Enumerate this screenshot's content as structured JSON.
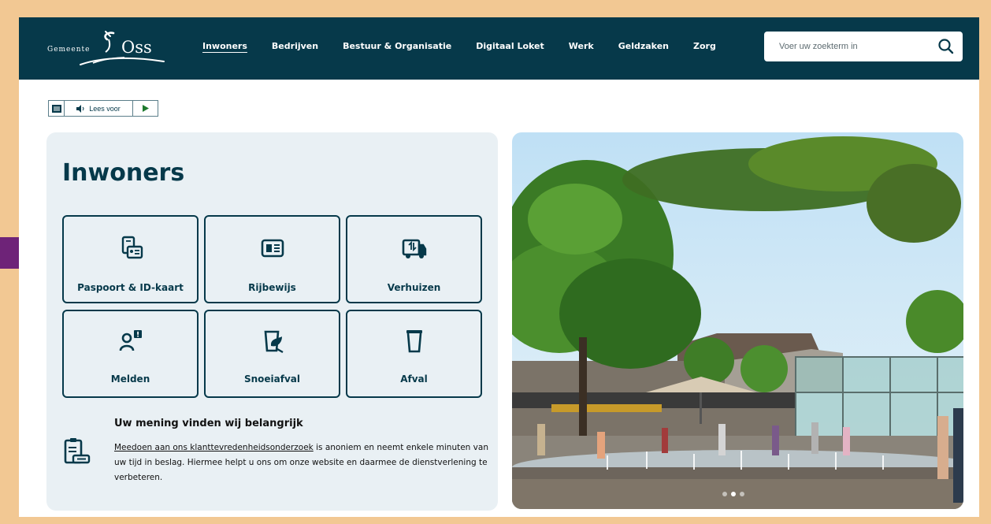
{
  "header": {
    "logo": {
      "small": "Gemeente",
      "big": "Oss"
    },
    "nav": [
      {
        "label": "Inwoners",
        "active": true
      },
      {
        "label": "Bedrijven"
      },
      {
        "label": "Bestuur & Organisatie"
      },
      {
        "label": "Digitaal Loket"
      },
      {
        "label": "Werk"
      },
      {
        "label": "Geldzaken"
      },
      {
        "label": "Zorg"
      }
    ],
    "search": {
      "placeholder": "Voer uw zoekterm in",
      "icon": "search-icon"
    }
  },
  "readspeaker": {
    "read_label": "Lees voor",
    "menu_icon": "menu-icon",
    "speaker_icon": "speaker-icon",
    "play_icon": "play-icon"
  },
  "panel": {
    "title": "Inwoners",
    "tiles": [
      {
        "label": "Paspoort & ID-kaart",
        "icon": "passport-icon"
      },
      {
        "label": "Rijbewijs",
        "icon": "driving-license-icon"
      },
      {
        "label": "Verhuizen",
        "icon": "moving-truck-icon"
      },
      {
        "label": "Melden",
        "icon": "report-icon"
      },
      {
        "label": "Snoeiafval",
        "icon": "garden-waste-icon"
      },
      {
        "label": "Afval",
        "icon": "waste-bin-icon"
      }
    ],
    "survey": {
      "title": "Uw mening vinden wij belangrijk",
      "link_text": "Meedoen aan ons klanttevredenheidsonderzoek",
      "text": " is anoniem en neemt enkele minuten van uw tijd in beslag. Hiermee helpt u ons om onze website en daarmee de dienstverlening te verbeteren.",
      "icon": "clipboard-icon"
    }
  },
  "hero": {
    "slides": 3,
    "active_slide": 2
  },
  "colors": {
    "brand": "#06394a",
    "panel": "#e9f0f4",
    "frame": "#f2c893",
    "arrow": "#6e2378"
  }
}
